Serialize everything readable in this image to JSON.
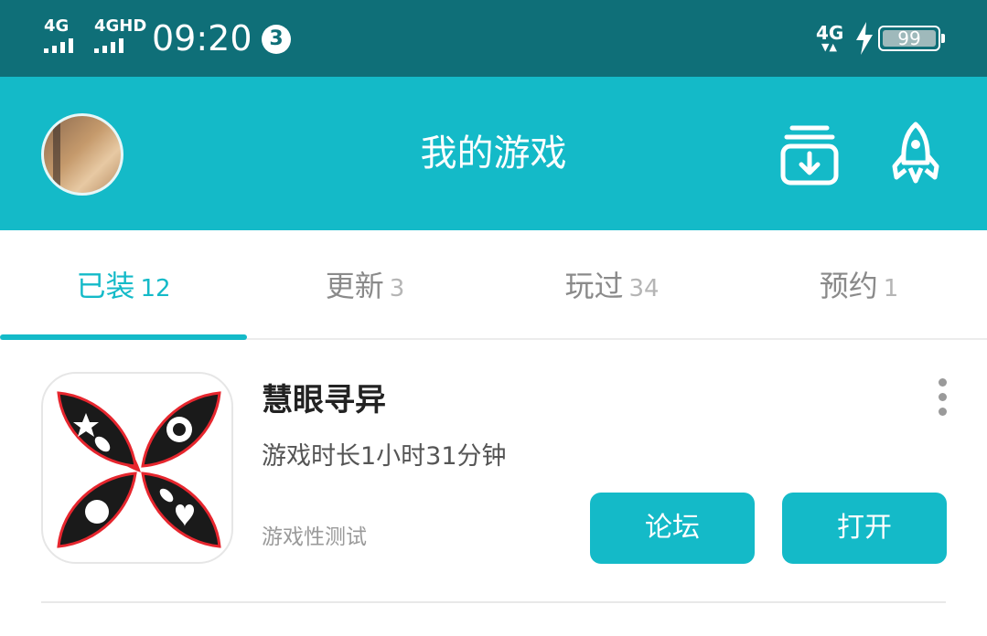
{
  "status_bar": {
    "sim1": "4G",
    "sim2": "4GHD",
    "time": "09:20",
    "notification_count": "3",
    "network_right": "4G",
    "battery": "99"
  },
  "header": {
    "title": "我的游戏",
    "icons": [
      "avatar",
      "download-manager-icon",
      "rocket-icon"
    ]
  },
  "tabs": [
    {
      "label": "已装",
      "count": "12",
      "active": true
    },
    {
      "label": "更新",
      "count": "3",
      "active": false
    },
    {
      "label": "玩过",
      "count": "34",
      "active": false
    },
    {
      "label": "预约",
      "count": "1",
      "active": false
    }
  ],
  "games": [
    {
      "name": "慧眼寻异",
      "playtime": "游戏时长1小时31分钟",
      "tag": "游戏性测试",
      "forum_label": "论坛",
      "open_label": "打开"
    }
  ],
  "colors": {
    "status_bar": "#0f6f78",
    "accent": "#14bac8",
    "text_dark": "#222222",
    "text_muted": "#9a9a9a"
  }
}
